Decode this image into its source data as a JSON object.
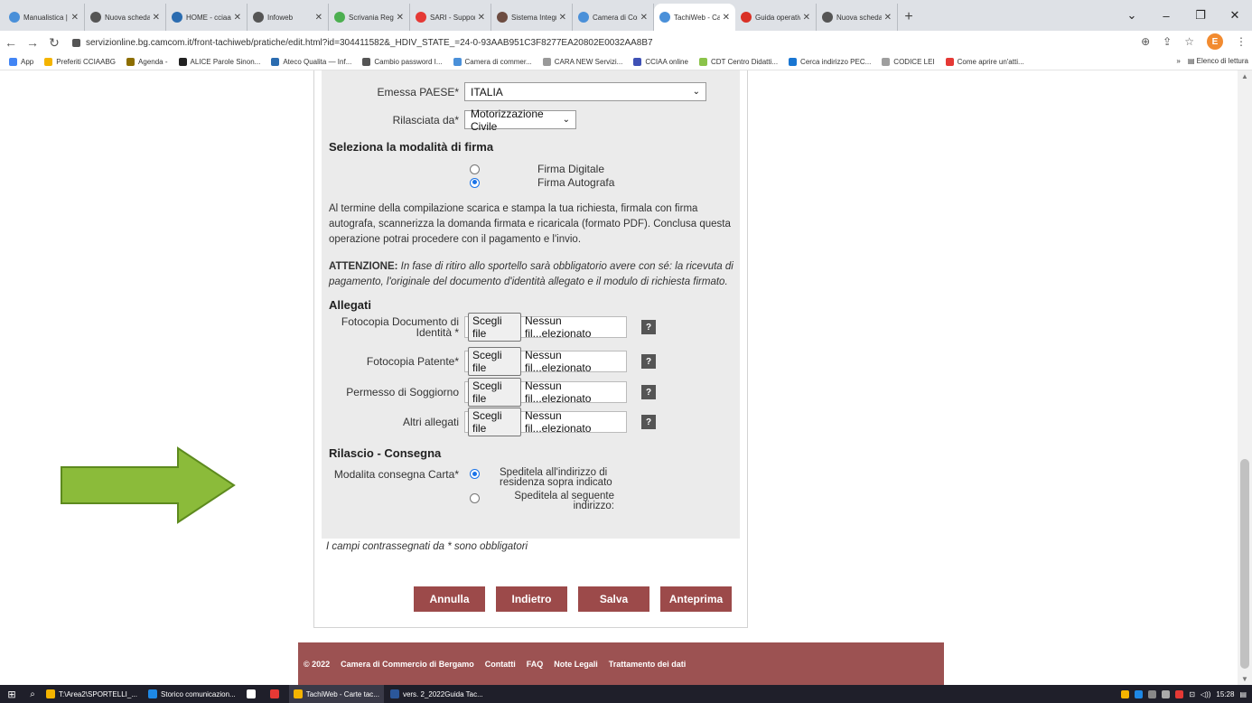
{
  "browser": {
    "tabs": [
      {
        "title": "Manualistica | C",
        "color": "#4a90d9"
      },
      {
        "title": "Nuova scheda",
        "color": "#555555"
      },
      {
        "title": "HOME - cciaa -",
        "color": "#2b6cb0"
      },
      {
        "title": "Infoweb",
        "color": "#555555"
      },
      {
        "title": "Scrivania Regist",
        "color": "#4caf50"
      },
      {
        "title": "SARI - Supporto",
        "color": "#e53935"
      },
      {
        "title": "Sistema Integra",
        "color": "#6d4c41"
      },
      {
        "title": "Camera di Com",
        "color": "#4a90d9"
      },
      {
        "title": "TachiWeb - Cart",
        "color": "#4a90d9"
      },
      {
        "title": "Guida operativa",
        "color": "#d93025"
      },
      {
        "title": "Nuova scheda",
        "color": "#555555"
      }
    ],
    "url": "servizionline.bg.camcom.it/front-tachiweb/pratiche/edit.html?id=304411582&_HDIV_STATE_=24-0-93AAB951C3F8277EA20802E0032AA8B7",
    "profile_initial": "E",
    "bookmarks": [
      {
        "label": "App",
        "color": "#4285f4"
      },
      {
        "label": "Preferiti CCIAABG",
        "color": "#f4b400"
      },
      {
        "label": "Agenda -",
        "color": "#8d6e00"
      },
      {
        "label": "ALICE Parole Sinon...",
        "color": "#222222"
      },
      {
        "label": "Ateco Qualita — Inf...",
        "color": "#2b6cb0"
      },
      {
        "label": "Cambio password I...",
        "color": "#555555"
      },
      {
        "label": "Camera di commer...",
        "color": "#4a90d9"
      },
      {
        "label": "CARA NEW Servizi...",
        "color": "#999999"
      },
      {
        "label": "CCIAA online",
        "color": "#3f51b5"
      },
      {
        "label": "CDT Centro Didatti...",
        "color": "#8bc34a"
      },
      {
        "label": "Cerca indirizzo PEC...",
        "color": "#1976d2"
      },
      {
        "label": "CODICE LEI",
        "color": "#9e9e9e"
      },
      {
        "label": "Come aprire un'atti...",
        "color": "#e53935"
      }
    ],
    "reading_list": "Elenco di lettura"
  },
  "form": {
    "emessa_label": "Emessa PAESE*",
    "emessa_value": "ITALIA",
    "rilasciata_label": "Rilasciata da*",
    "rilasciata_value": "Motorizzazione Civile",
    "firma_title": "Seleziona la modalità di firma",
    "firma_digitale": "Firma Digitale",
    "firma_autografa": "Firma Autografa",
    "info_text": "Al termine della compilazione scarica e stampa la tua richiesta, firmala con firma autografa, scannerizza la domanda firmata e ricaricala (formato PDF). Conclusa questa operazione potrai procedere con il pagamento e l'invio.",
    "attenzione_label": "ATTENZIONE:",
    "attenzione_text": " In fase di ritiro allo sportello sarà obbligatorio avere con sé: la ricevuta di pagamento, l'originale del documento d'identità allegato e il modulo di richiesta firmato.",
    "allegati_title": "Allegati",
    "file_button": "Scegli file",
    "file_status": "Nessun fil...elezionato",
    "help": "?",
    "allegati": [
      {
        "label": "Fotocopia Documento di Identità *"
      },
      {
        "label": "Fotocopia Patente*"
      },
      {
        "label": "Permesso di Soggiorno"
      },
      {
        "label": "Altri allegati"
      }
    ],
    "rilascio_title": "Rilascio - Consegna",
    "consegna_label": "Modalita consegna Carta*",
    "consegna_opt1": "Speditela all'indirizzo di residenza sopra indicato",
    "consegna_opt2": "Speditela al seguente indirizzo:",
    "required_note": "I campi contrassegnati da * sono obbligatori",
    "buttons": {
      "annulla": "Annulla",
      "indietro": "Indietro",
      "salva": "Salva",
      "anteprima": "Anteprima"
    }
  },
  "footer": {
    "copyright": "© 2022",
    "links": [
      "Camera di Commercio di Bergamo",
      "Contatti",
      "FAQ",
      "Note Legali",
      "Trattamento dei dati"
    ]
  },
  "taskbar": {
    "items": [
      {
        "label": "T:\\Area2\\SPORTELLI_...",
        "color": "#f4b400"
      },
      {
        "label": "Storico comunicazion...",
        "color": "#1e88e5"
      },
      {
        "label": "",
        "color": "#ffffff"
      },
      {
        "label": "",
        "color": "#e53935"
      },
      {
        "label": "TachiWeb - Carte tac...",
        "color": "#f4b400"
      },
      {
        "label": "vers. 2_2022Guida Tac...",
        "color": "#2b579a"
      }
    ],
    "clock": "15:28"
  },
  "colors": {
    "button_bg": "#9c4a4a",
    "footer_bg": "#9c5252",
    "arrow_fill": "#8bbb3a",
    "arrow_stroke": "#5d8a1e",
    "panel_bg": "#ebebeb"
  }
}
